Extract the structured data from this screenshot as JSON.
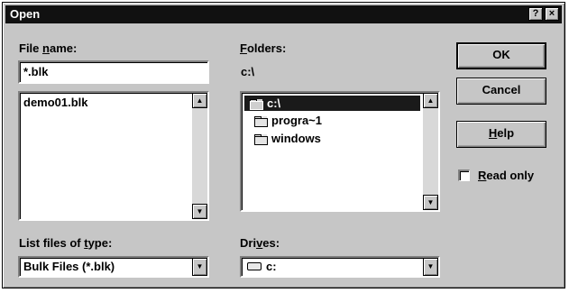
{
  "dialog": {
    "title": "Open"
  },
  "title_buttons": {
    "help": "?",
    "close": "×"
  },
  "file_name": {
    "label_pre": "File ",
    "label_accel": "n",
    "label_post": "ame:",
    "value": "*.blk",
    "files": [
      "demo01.blk"
    ]
  },
  "folders": {
    "label_accel": "F",
    "label_post": "olders:",
    "current_path": "c:\\",
    "items": [
      {
        "name": "c:\\",
        "state": "open",
        "selected": true
      },
      {
        "name": "progra~1",
        "state": "closed",
        "selected": false
      },
      {
        "name": "windows",
        "state": "closed",
        "selected": false
      }
    ]
  },
  "file_type": {
    "label_pre": "List files of ",
    "label_accel": "t",
    "label_post": "ype:",
    "value": "Bulk Files (*.blk)"
  },
  "drives": {
    "label_pre": "Dri",
    "label_accel": "v",
    "label_post": "es:",
    "value": "c:"
  },
  "buttons": {
    "ok": "OK",
    "cancel": "Cancel",
    "help_accel": "H",
    "help_post": "elp"
  },
  "read_only": {
    "label_accel": "R",
    "label_post": "ead only",
    "checked": false
  },
  "icons": {
    "scroll_up": "▲",
    "scroll_down": "▼",
    "combo_arrow": "▼"
  },
  "colors": {
    "face": "#c6c6c6",
    "titlebar": "#111111",
    "selection": "#1a1a1a",
    "field": "#ffffff"
  }
}
